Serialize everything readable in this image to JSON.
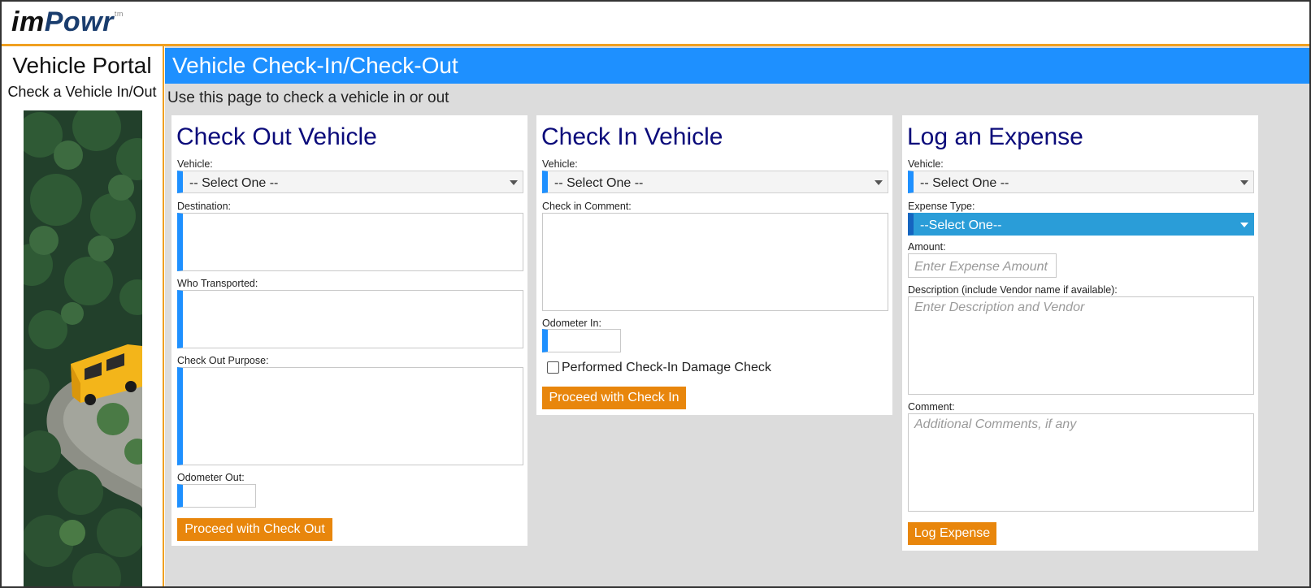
{
  "header": {
    "logo_im": "im",
    "logo_powr": "Powr",
    "logo_tm": "tm"
  },
  "sidebar": {
    "title": "Vehicle Portal",
    "subtitle": "Check a Vehicle In/Out"
  },
  "main": {
    "banner": "Vehicle Check-In/Check-Out",
    "intro": "Use this page to check a vehicle in or out"
  },
  "checkout": {
    "title": "Check Out Vehicle",
    "vehicle_label": "Vehicle:",
    "vehicle_value": "-- Select One --",
    "destination_label": "Destination:",
    "who_label": "Who Transported:",
    "purpose_label": "Check Out Purpose:",
    "odometer_label": "Odometer Out:",
    "button": "Proceed with Check Out"
  },
  "checkin": {
    "title": "Check In Vehicle",
    "vehicle_label": "Vehicle:",
    "vehicle_value": "-- Select One --",
    "comment_label": "Check in Comment:",
    "odometer_label": "Odometer In:",
    "damage_label": "Performed Check-In Damage Check",
    "button": "Proceed with Check In"
  },
  "expense": {
    "title": "Log an Expense",
    "vehicle_label": "Vehicle:",
    "vehicle_value": "-- Select One --",
    "type_label": "Expense Type:",
    "type_value": "--Select One--",
    "amount_label": "Amount:",
    "amount_placeholder": "Enter Expense Amount",
    "description_label": "Description (include Vendor name if available):",
    "description_placeholder": "Enter Description and Vendor",
    "comment_label": "Comment:",
    "comment_placeholder": "Additional Comments, if any",
    "button": "Log Expense"
  },
  "colors": {
    "banner": "#1e90ff",
    "accent_orange": "#e8860c",
    "title_navy": "#0b0b7a"
  }
}
